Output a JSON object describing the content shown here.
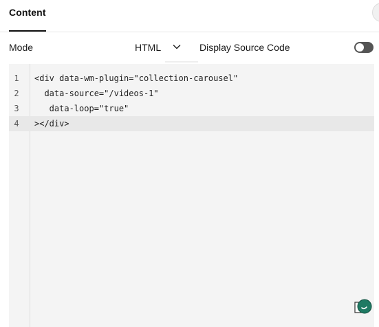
{
  "tabs": {
    "active_label": "Content"
  },
  "mode_row": {
    "label": "Mode",
    "selected_mode": "HTML",
    "display_source_label": "Display Source Code",
    "display_source_enabled": false
  },
  "editor": {
    "lines": [
      {
        "number": "1",
        "text": "<div data-wm-plugin=\"collection-carousel\""
      },
      {
        "number": "2",
        "text": "  data-source=\"/videos-1\""
      },
      {
        "number": "3",
        "text": "   data-loop=\"true\""
      },
      {
        "number": "4",
        "text": "></div>"
      }
    ],
    "active_line": 4
  },
  "icons": {
    "mode_dropdown": "chevron-down-icon",
    "assistant": "assistant-bubble-icon"
  },
  "colors": {
    "editor_bg": "#f4f4f4",
    "active_line_bg": "#e8e8e8",
    "toggle_off": "#555555",
    "assistant_green": "#1f7a63"
  }
}
